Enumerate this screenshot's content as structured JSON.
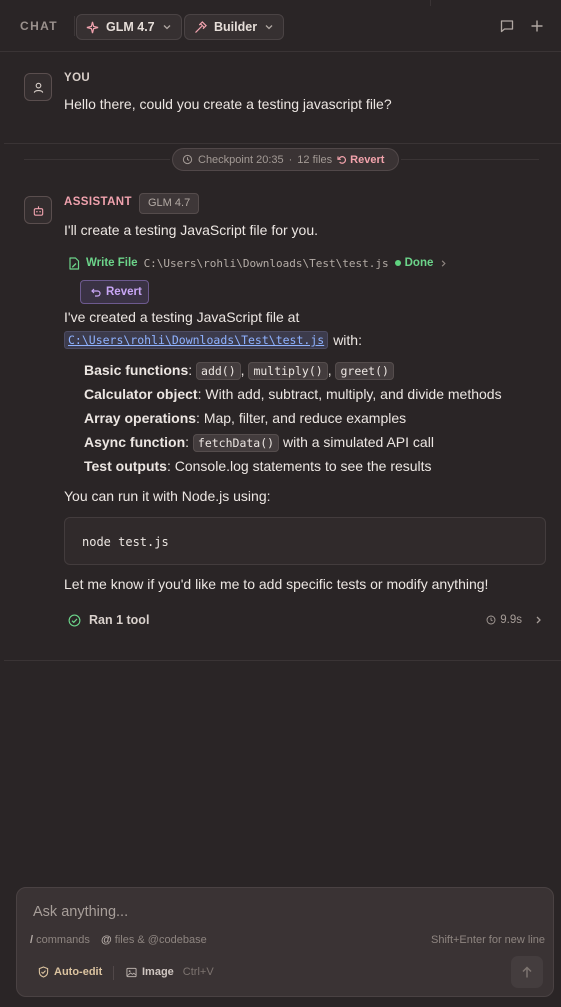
{
  "header": {
    "chat_label": "CHAT",
    "model_label": "GLM 4.7",
    "mode_label": "Builder"
  },
  "user_message": {
    "role": "YOU",
    "text": "Hello there, could you create a testing javascript file?"
  },
  "checkpoint": {
    "time": "Checkpoint 20:35",
    "sep": "·",
    "files": "12 files",
    "revert_label": "Revert"
  },
  "assistant": {
    "role": "ASSISTANT",
    "model_badge": "GLM 4.7",
    "intro": "I'll create a testing JavaScript file for you.",
    "tool": {
      "label": "Write File",
      "path": "C:\\Users\\rohli\\Downloads\\Test\\test.js",
      "status": "Done"
    },
    "revert_label": "Revert",
    "created_prefix": "I've created a testing JavaScript file at",
    "created_path": "C:\\Users\\rohli\\Downloads\\Test\\test.js",
    "created_suffix": "with:",
    "bullets": {
      "b1_title": "Basic functions",
      "b1_colon": ":",
      "b1_code1": "add()",
      "b1_code2": "multiply()",
      "b1_code3": "greet()",
      "b1_comma": ",",
      "b2_title": "Calculator object",
      "b2_text": ": With add, subtract, multiply, and divide methods",
      "b3_title": "Array operations",
      "b3_text": ": Map, filter, and reduce examples",
      "b4_title": "Async function",
      "b4_colon": ":",
      "b4_code": "fetchData()",
      "b4_text": "with a simulated API call",
      "b5_title": "Test outputs",
      "b5_text": ": Console.log statements to see the results"
    },
    "run_prompt": "You can run it with Node.js using:",
    "code": "node test.js",
    "closing": "Let me know if you'd like me to add specific tests or modify anything!",
    "ran_tools": "Ran 1 tool",
    "duration": "9.9s"
  },
  "composer": {
    "placeholder": "Ask anything...",
    "hint_slash": "/",
    "hint_commands": "commands",
    "hint_at": "@",
    "hint_files": "files & @codebase",
    "hint_newline": "Shift+Enter for new line",
    "auto_edit": "Auto-edit",
    "image": "Image",
    "image_shortcut": "Ctrl+V"
  },
  "colors": {
    "background": "#2a2526",
    "user_role": "#d9cfc9",
    "assistant_role": "#f0a2ae",
    "success": "#6cd48a",
    "revert_purple": "#c8a6f5",
    "link": "#8fb2ff"
  }
}
